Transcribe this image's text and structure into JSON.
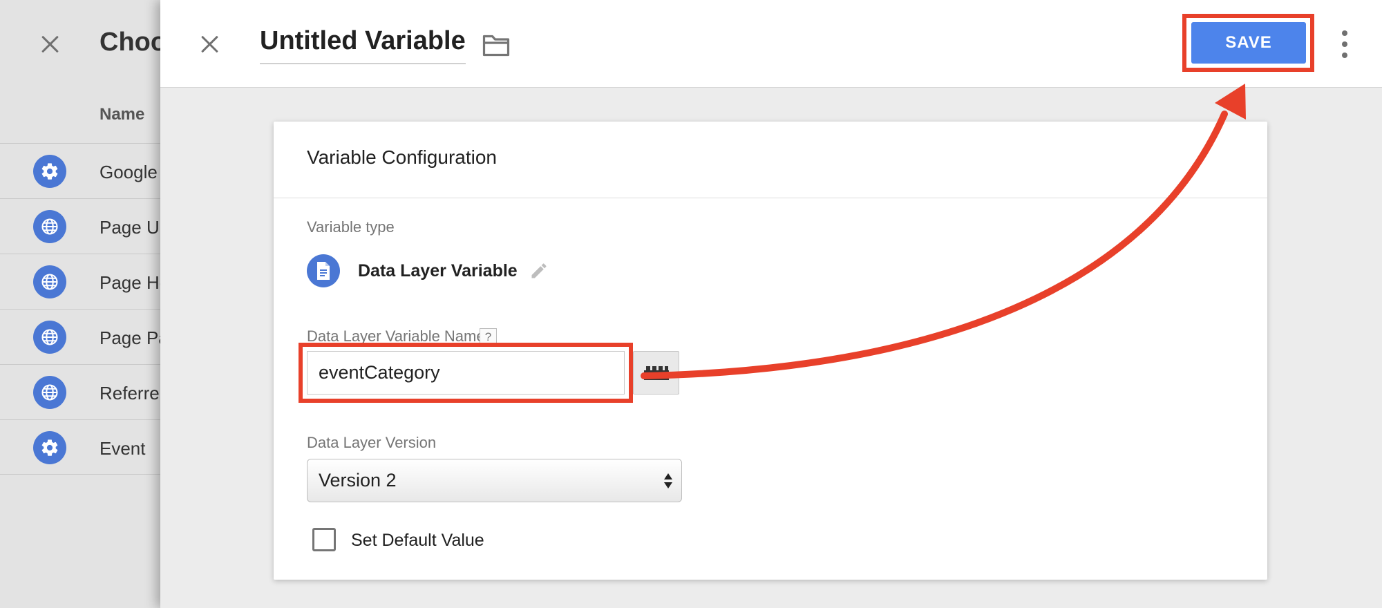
{
  "background_panel": {
    "title": "Choo",
    "column_header": "Name",
    "rows": [
      {
        "label": "Google",
        "icon": "gear-icon"
      },
      {
        "label": "Page UI",
        "icon": "globe-icon"
      },
      {
        "label": "Page Ho",
        "icon": "globe-icon"
      },
      {
        "label": "Page Pa",
        "icon": "globe-icon"
      },
      {
        "label": "Referrer",
        "icon": "globe-icon"
      },
      {
        "label": "Event",
        "icon": "gear-icon"
      }
    ]
  },
  "header": {
    "title": "Untitled Variable",
    "save_label": "SAVE"
  },
  "card": {
    "title": "Variable Configuration",
    "variable_type_label": "Variable type",
    "variable_type_name": "Data Layer Variable",
    "name_field_label": "Data Layer Variable Name",
    "help_glyph": "?",
    "name_field_value": "eventCategory",
    "version_label": "Data Layer Version",
    "version_value": "Version 2",
    "default_value_label": "Set Default Value",
    "default_value_checked": false
  },
  "colors": {
    "accent_blue": "#4d84eb",
    "icon_blue": "#4a77d4",
    "annotation_red": "#e8402a"
  }
}
